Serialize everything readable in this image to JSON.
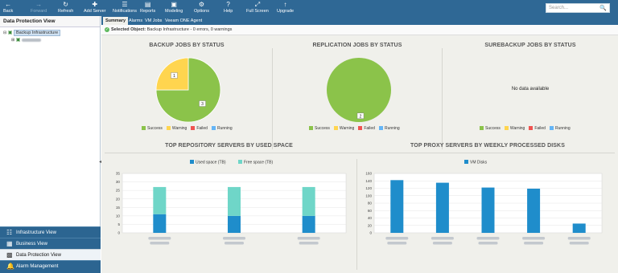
{
  "toolbar": {
    "buttons": [
      {
        "label": "Back",
        "icon": "back-arrow-icon",
        "disabled": false
      },
      {
        "label": "Forward",
        "icon": "forward-arrow-icon",
        "disabled": true
      },
      {
        "label": "Refresh",
        "icon": "refresh-icon",
        "disabled": false
      },
      {
        "label": "Add Server",
        "icon": "add-server-icon",
        "disabled": false
      },
      {
        "label": "Notifications",
        "icon": "notifications-icon",
        "disabled": false
      },
      {
        "label": "Reports",
        "icon": "reports-icon",
        "disabled": false
      },
      {
        "label": "Modeling",
        "icon": "modeling-icon",
        "disabled": false
      },
      {
        "label": "Options",
        "icon": "options-icon",
        "disabled": false
      },
      {
        "label": "Help",
        "icon": "help-icon",
        "disabled": false
      },
      {
        "label": "Full Screen",
        "icon": "fullscreen-icon",
        "disabled": false
      },
      {
        "label": "Upgrade",
        "icon": "upgrade-icon",
        "disabled": false
      }
    ],
    "search_placeholder": "Search..."
  },
  "left_panel": {
    "title": "Data Protection View",
    "tree_root": "Backup Infrastructure"
  },
  "nav": [
    {
      "label": "Infrastructure View",
      "icon": "infrastructure-icon",
      "active": false
    },
    {
      "label": "Business View",
      "icon": "business-icon",
      "active": false
    },
    {
      "label": "Data Protection View",
      "icon": "data-protection-icon",
      "active": true
    },
    {
      "label": "Alarm Management",
      "icon": "alarm-icon",
      "active": false
    }
  ],
  "tabs": [
    "Summary",
    "Alarms",
    "VM Jobs",
    "Veeam ONE Agent"
  ],
  "active_tab": "Summary",
  "selected_object": {
    "label": "Selected Object:",
    "value": "Backup Infrastructure - 0 errors, 0 warnings"
  },
  "colors": {
    "success": "#8bc34a",
    "warning": "#ffd54f",
    "failed": "#ef5350",
    "running": "#64b5f6",
    "used": "#1f8dcb",
    "free": "#6fd6c8",
    "toolbar": "#2f6895"
  },
  "status_legend": [
    "Success",
    "Warning",
    "Failed",
    "Running"
  ],
  "panels": {
    "backup": {
      "title": "BACKUP JOBS BY STATUS"
    },
    "replication": {
      "title": "REPLICATION JOBS BY STATUS"
    },
    "surebackup": {
      "title": "SUREBACKUP JOBS BY STATUS",
      "nodata": "No data available"
    },
    "repo": {
      "title": "TOP REPOSITORY SERVERS BY USED SPACE"
    },
    "proxy": {
      "title": "TOP PROXY SERVERS BY WEEKLY PROCESSED DISKS"
    }
  },
  "chart_data": [
    {
      "type": "pie",
      "title": "BACKUP JOBS BY STATUS",
      "categories": [
        "Success",
        "Warning",
        "Failed",
        "Running"
      ],
      "values": [
        3,
        1,
        0,
        0
      ],
      "legend_position": "bottom"
    },
    {
      "type": "pie",
      "title": "REPLICATION JOBS BY STATUS",
      "categories": [
        "Success",
        "Warning",
        "Failed",
        "Running"
      ],
      "values": [
        2,
        0,
        0,
        0
      ],
      "legend_position": "bottom"
    },
    {
      "type": "pie",
      "title": "SUREBACKUP JOBS BY STATUS",
      "categories": [
        "Success",
        "Warning",
        "Failed",
        "Running"
      ],
      "values": [],
      "legend_position": "bottom"
    },
    {
      "type": "bar",
      "stacked": true,
      "title": "TOP REPOSITORY SERVERS BY USED SPACE",
      "categories": [
        "",
        "",
        ""
      ],
      "series": [
        {
          "name": "Used space (TB)",
          "values": [
            11,
            10,
            10
          ]
        },
        {
          "name": "Free space (TB)",
          "values": [
            16,
            17,
            17
          ]
        }
      ],
      "ylim": [
        0,
        35
      ],
      "yticks": [
        0,
        5,
        10,
        15,
        20,
        25,
        30,
        35
      ],
      "grid": true,
      "legend_position": "top"
    },
    {
      "type": "bar",
      "title": "TOP PROXY SERVERS BY WEEKLY PROCESSED DISKS",
      "categories": [
        "",
        "",
        "",
        "",
        ""
      ],
      "series": [
        {
          "name": "VM Disks",
          "values": [
            142,
            135,
            122,
            119,
            25
          ]
        }
      ],
      "ylim": [
        0,
        160
      ],
      "yticks": [
        0,
        20,
        40,
        60,
        80,
        100,
        120,
        140,
        160
      ],
      "grid": true,
      "legend_position": "top"
    }
  ]
}
